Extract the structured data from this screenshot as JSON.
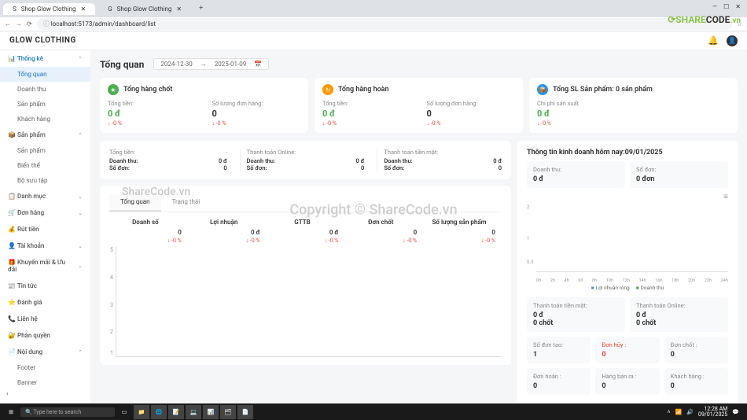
{
  "browser": {
    "tabs": [
      {
        "title": "Shop Glow Clothing",
        "favicon": "S"
      },
      {
        "title": "Shop Glow Clothing",
        "favicon": "G"
      }
    ],
    "url": "localhost:5173/admin/dashboard/list",
    "win": {
      "min": "—",
      "max": "☐",
      "close": "✕"
    }
  },
  "watermark": {
    "logo1": "SHARE",
    "logo2": "CODE",
    "logo3": ".vn",
    "center": "Copyright © ShareCode.vn",
    "left": "ShareCode.vn"
  },
  "header": {
    "logo": "GLOW CLOTHING",
    "bell": "🔔",
    "user": "👤"
  },
  "sidebar": {
    "groups": [
      {
        "icon": "📊",
        "label": "Thống kê",
        "expanded": true,
        "items": [
          {
            "label": "Tổng quan",
            "active": true
          },
          {
            "label": "Doanh thu"
          },
          {
            "label": "Sản phẩm"
          },
          {
            "label": "Khách hàng"
          }
        ]
      },
      {
        "icon": "📦",
        "label": "Sản phẩm",
        "expanded": true,
        "items": [
          {
            "label": "Sản phẩm"
          },
          {
            "label": "Biến thể"
          },
          {
            "label": "Bộ sưu tập"
          }
        ]
      },
      {
        "icon": "📋",
        "label": "Danh mục"
      },
      {
        "icon": "🛒",
        "label": "Đơn hàng"
      },
      {
        "icon": "💰",
        "label": "Rút tiền"
      },
      {
        "icon": "👤",
        "label": "Tài khoản"
      },
      {
        "icon": "🎁",
        "label": "Khuyến mãi & Ưu đãi"
      },
      {
        "icon": "📰",
        "label": "Tin tức"
      },
      {
        "icon": "⭐",
        "label": "Đánh giá"
      },
      {
        "icon": "📞",
        "label": "Liên hệ"
      },
      {
        "icon": "🔐",
        "label": "Phân quyền"
      },
      {
        "icon": "📄",
        "label": "Nội dung",
        "expanded": true,
        "items": [
          {
            "label": "Footer"
          },
          {
            "label": "Banner"
          }
        ]
      }
    ]
  },
  "page": {
    "title": "Tổng quan",
    "date_from": "2024-12-30",
    "date_to": "2025-01-09"
  },
  "top_cards": [
    {
      "icon_class": "ic-green",
      "icon": "★",
      "title": "Tổng hàng chốt",
      "blocks": [
        {
          "label": "Tổng tiền:",
          "val": "0 đ",
          "green": true,
          "trend": "↓ -0 %"
        },
        {
          "label": "Số lượng đơn hàng:",
          "val": "0",
          "trend": "↓ -0 %"
        }
      ]
    },
    {
      "icon_class": "ic-orange",
      "icon": "↻",
      "title": "Tổng hàng hoàn",
      "blocks": [
        {
          "label": "Tổng tiền:",
          "val": "0 đ",
          "green": true,
          "trend": "↓ -0 %"
        },
        {
          "label": "Số lượng đơn hàng:",
          "val": "0",
          "trend": "↓ -0 %"
        }
      ]
    },
    {
      "icon_class": "ic-blue",
      "icon": "📦",
      "title": "Tổng SL Sản phẩm: 0 sản phẩm",
      "blocks": [
        {
          "label": "Chi phí sản xuất",
          "val": "0 đ",
          "green": true,
          "trend": "↓ -0 %"
        }
      ]
    }
  ],
  "summary": [
    {
      "rows": [
        {
          "l": "Tổng tiền:",
          "v": "-"
        },
        {
          "l": "Doanh thu:",
          "v": "0 đ"
        },
        {
          "l": "Số đơn:",
          "v": "0"
        }
      ]
    },
    {
      "rows": [
        {
          "l": "Thanh toán Online:",
          "v": ""
        },
        {
          "l": "Doanh thu:",
          "v": "0 đ"
        },
        {
          "l": "Số đơn:",
          "v": "0"
        }
      ]
    },
    {
      "rows": [
        {
          "l": "Thanh toán tiền mặt:",
          "v": ""
        },
        {
          "l": "Doanh thu:",
          "v": "0 đ"
        },
        {
          "l": "Số đơn:",
          "v": "0"
        }
      ]
    }
  ],
  "tabs": {
    "active": "Tổng quan",
    "other": "Trạng thái"
  },
  "stats": [
    {
      "label": "Doanh số",
      "val": "0",
      "trend": "↓ -0 %"
    },
    {
      "label": "Lợi nhuận",
      "val": "0 đ",
      "trend": "↓ -0 %"
    },
    {
      "label": "GTTB",
      "val": "0 đ",
      "trend": "↓ -0 %"
    },
    {
      "label": "Đơn chốt",
      "val": "0",
      "trend": "↓ -0 %"
    },
    {
      "label": "Số lượng sản phẩm",
      "val": "0",
      "trend": "↓ -0 %"
    }
  ],
  "chart_data": {
    "type": "line",
    "y_ticks": [
      "5",
      "4",
      "3",
      "2",
      "1"
    ],
    "series": [],
    "title": ""
  },
  "right": {
    "title": "Thông tin kinh doanh hôm nay:09/01/2025",
    "top": [
      {
        "label": "Doanh thu:",
        "val": "0 đ"
      },
      {
        "label": "Số đơn:",
        "val": "0 đơn"
      }
    ],
    "chart": {
      "type": "line",
      "y_ticks": [
        "2",
        "1",
        "0.5"
      ],
      "x_ticks": [
        "0h",
        "2h",
        "4h",
        "6h",
        "8h",
        "10h",
        "12h",
        "14h",
        "16h",
        "18h",
        "20h",
        "22h",
        "24h"
      ],
      "legend": [
        "Lợi nhuận ròng",
        "Doanh thu"
      ],
      "series": [
        {
          "name": "Lợi nhuận ròng",
          "values": []
        },
        {
          "name": "Doanh thu",
          "values": []
        }
      ]
    },
    "grid1": [
      {
        "label": "Thanh toán tiền mặt:",
        "val": "0 đ",
        "sub": "0 chốt"
      },
      {
        "label": "Thanh toán Online:",
        "val": "0 đ",
        "sub": "0 chốt"
      }
    ],
    "grid2": [
      {
        "label": "Số đơn tạo:",
        "val": "1"
      },
      {
        "label": "Đơn hủy :",
        "val": "0",
        "red": true
      },
      {
        "label": "Đơn chốt :",
        "val": "0"
      }
    ],
    "grid3": [
      {
        "label": "Đơn hoàn :",
        "val": "0"
      },
      {
        "label": "Hàng bán ra :",
        "val": "0"
      },
      {
        "label": "Khách hàng :",
        "val": "0"
      }
    ]
  },
  "taskbar": {
    "search": "Type here to search",
    "time": "12:28 AM",
    "date": "09/01/2025"
  }
}
